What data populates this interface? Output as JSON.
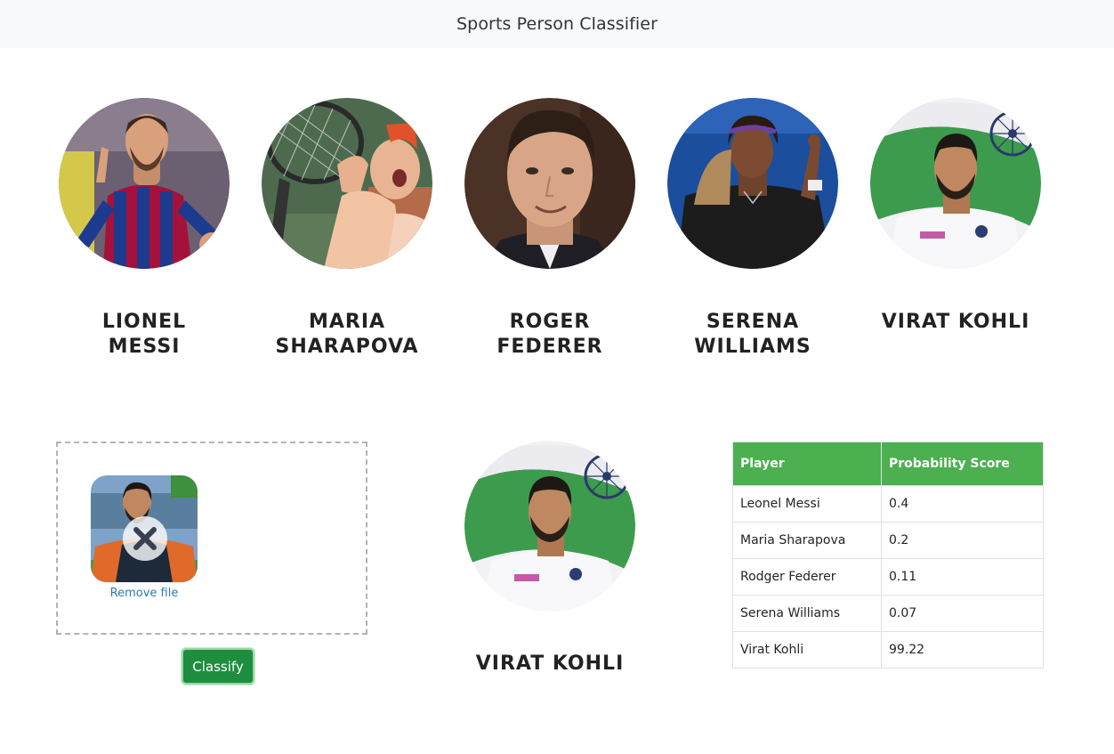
{
  "navbar": {
    "title": "Sports Person Classifier"
  },
  "players": [
    {
      "name": "LIONEL\nMESSI",
      "image": "lionel-messi-photo"
    },
    {
      "name": "MARIA\nSHARAPOVA",
      "image": "maria-sharapova-photo"
    },
    {
      "name": "ROGER\nFEDERER",
      "image": "roger-federer-photo"
    },
    {
      "name": "SERENA\nWILLIAMS",
      "image": "serena-williams-photo"
    },
    {
      "name": "VIRAT KOHLI",
      "image": "virat-kohli-photo"
    }
  ],
  "upload": {
    "thumbnail": "uploaded-virat-kohli-photo",
    "remove_label": "Remove file",
    "remove_icon": "close-icon"
  },
  "classify_button": {
    "label": "Classify"
  },
  "result": {
    "name": "VIRAT KOHLI",
    "image": "virat-kohli-photo"
  },
  "probability_table": {
    "columns": [
      "Player",
      "Probability Score"
    ],
    "rows": [
      [
        "Leonel Messi",
        "0.4"
      ],
      [
        "Maria Sharapova",
        "0.2"
      ],
      [
        "Rodger Federer",
        "0.11"
      ],
      [
        "Serena Williams",
        "0.07"
      ],
      [
        "Virat Kohli",
        "99.22"
      ]
    ]
  },
  "colors": {
    "header_bg": "#f8f9fa",
    "table_header": "#4caf50",
    "button": "#1e8e3e",
    "link": "#2a7ab8"
  }
}
